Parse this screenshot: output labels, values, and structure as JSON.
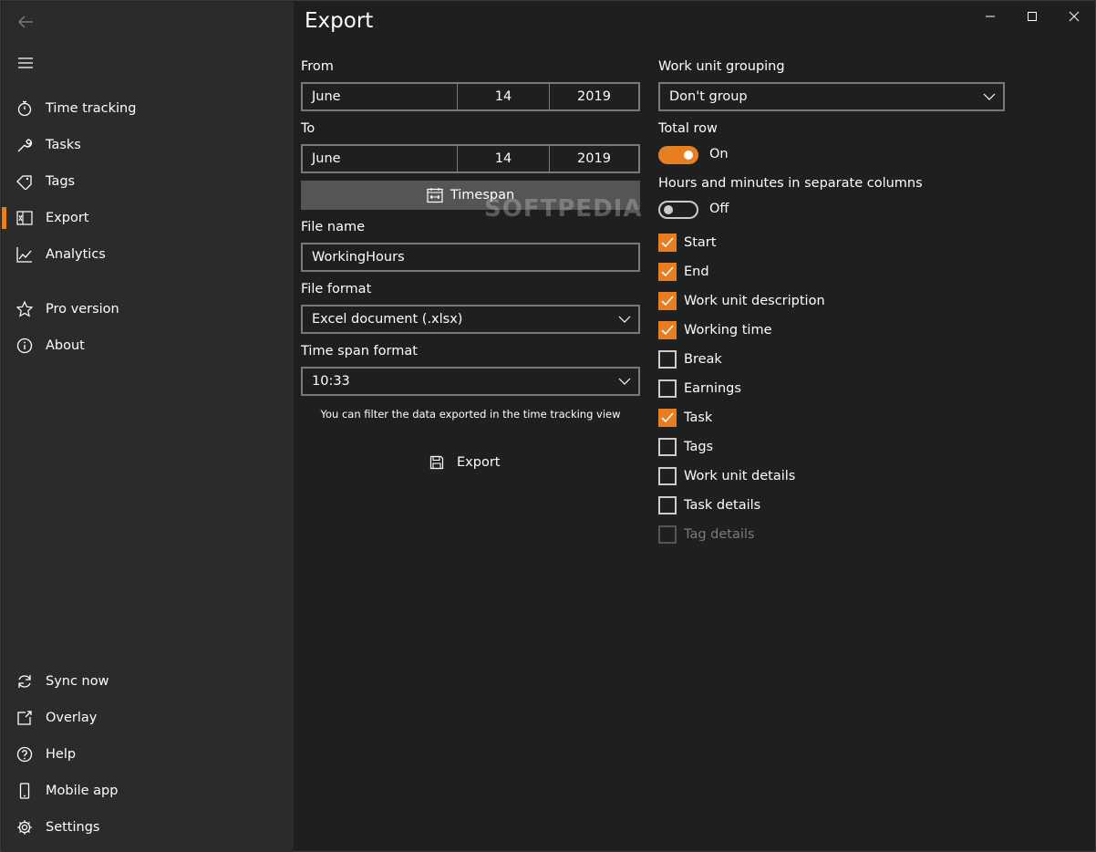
{
  "page": {
    "title": "Export"
  },
  "sidebar": {
    "items": [
      {
        "label": "Time tracking",
        "icon": "stopwatch-icon"
      },
      {
        "label": "Tasks",
        "icon": "wrench-icon"
      },
      {
        "label": "Tags",
        "icon": "tag-icon"
      },
      {
        "label": "Export",
        "icon": "excel-icon",
        "active": true
      },
      {
        "label": "Analytics",
        "icon": "chart-icon"
      },
      {
        "label": "Pro version",
        "icon": "star-icon"
      },
      {
        "label": "About",
        "icon": "info-icon"
      }
    ],
    "bottom_items": [
      {
        "label": "Sync now",
        "icon": "sync-icon"
      },
      {
        "label": "Overlay",
        "icon": "overlay-icon"
      },
      {
        "label": "Help",
        "icon": "help-icon"
      },
      {
        "label": "Mobile app",
        "icon": "phone-icon"
      },
      {
        "label": "Settings",
        "icon": "gear-icon"
      }
    ]
  },
  "form": {
    "from_label": "From",
    "from": {
      "month": "June",
      "day": "14",
      "year": "2019"
    },
    "to_label": "To",
    "to": {
      "month": "June",
      "day": "14",
      "year": "2019"
    },
    "timespan_label": "Timespan",
    "file_name_label": "File name",
    "file_name_value": "WorkingHours",
    "file_format_label": "File format",
    "file_format_value": "Excel document (.xlsx)",
    "time_span_format_label": "Time span format",
    "time_span_format_value": "10:33",
    "hint": "You can filter the data exported in the time tracking view",
    "export_label": "Export"
  },
  "options": {
    "grouping_label": "Work unit grouping",
    "grouping_value": "Don't group",
    "total_row_label": "Total row",
    "total_row_state": "On",
    "separate_columns_label": "Hours and minutes in separate columns",
    "separate_columns_state": "Off",
    "columns": [
      {
        "label": "Start",
        "checked": true
      },
      {
        "label": "End",
        "checked": true
      },
      {
        "label": "Work unit description",
        "checked": true
      },
      {
        "label": "Working time",
        "checked": true
      },
      {
        "label": "Break",
        "checked": false
      },
      {
        "label": "Earnings",
        "checked": false
      },
      {
        "label": "Task",
        "checked": true
      },
      {
        "label": "Tags",
        "checked": false
      },
      {
        "label": "Work unit details",
        "checked": false
      },
      {
        "label": "Task details",
        "checked": false
      },
      {
        "label": "Tag details",
        "checked": false,
        "disabled": true
      }
    ]
  },
  "watermark": "SOFTPEDIA",
  "colors": {
    "accent": "#e67e22",
    "sidebar": "#2b2b2b",
    "main": "#1f1f1f"
  }
}
